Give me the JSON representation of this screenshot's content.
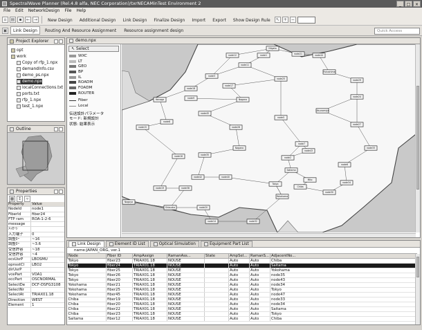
{
  "window": {
    "title": "SpectralWave Planner (Rel.4.8 alfa, NEC Corporation)/txrNECAMinTest Environment 2",
    "controls": [
      "_",
      "□",
      "×"
    ]
  },
  "menu": [
    "File",
    "Edit",
    "NetworkDesign",
    "File",
    "Help"
  ],
  "toolbar": {
    "buttons": [
      "New Design",
      "Additional Design",
      "Link Design",
      "Finalize Design",
      "Import",
      "Export",
      "Show Design Rule"
    ],
    "zoom": ""
  },
  "toolbar2": {
    "tabs": [
      "Link Design",
      "Routing And Resource Assignment",
      "Resource assignment design"
    ],
    "quick_access": "Quick Access"
  },
  "project_explorer": {
    "title": "Project Explorer",
    "items": [
      {
        "label": "opt",
        "type": "folder",
        "level": 0
      },
      {
        "label": "work",
        "type": "folder",
        "level": 0
      },
      {
        "label": "Copy of rfp_1.npx",
        "type": "file",
        "level": 1
      },
      {
        "label": "demandInfo.csv",
        "type": "file",
        "level": 1
      },
      {
        "label": "demo_ps.npx",
        "type": "file",
        "level": 1
      },
      {
        "label": "demo.npx",
        "type": "file",
        "level": 1,
        "selected": true
      },
      {
        "label": "localConnections.txt",
        "type": "file",
        "level": 1
      },
      {
        "label": "ports.txt",
        "type": "file",
        "level": 1
      },
      {
        "label": "rfp_1.npx",
        "type": "file",
        "level": 1
      },
      {
        "label": "test_1.npx",
        "type": "file",
        "level": 1
      }
    ]
  },
  "outline": {
    "title": "Outline"
  },
  "properties": {
    "title": "Properties",
    "col_property": "Property",
    "col_value": "Value",
    "rows": [
      [
        "NodeId",
        "node1"
      ],
      [
        "FiberId",
        "fiber24"
      ],
      [
        "FTP ram",
        "ROA-1-2-6"
      ],
      [
        "message",
        ""
      ],
      [
        "ﾒｯｾｰｼﾞ",
        ""
      ],
      [
        "入力端子",
        "0"
      ],
      [
        "調整ｶｰ",
        "~16"
      ],
      [
        "調整ｶｰ",
        "~3.6"
      ],
      [
        "受信許容",
        "~18"
      ],
      [
        "受信許容",
        "~4"
      ],
      [
        "ocsUsrP",
        "LBOSMU"
      ],
      [
        "opnsstCl",
        "LBO2"
      ],
      [
        "dirUsrP",
        ""
      ],
      [
        "vcePart",
        "VOA1"
      ],
      [
        "occPart",
        "OSCNORMAL"
      ],
      [
        "SelectDe",
        "DCF-DSFG3108"
      ],
      [
        "SelectNr",
        ""
      ],
      [
        "SelectAt",
        "TRIAX01.18"
      ],
      [
        "Direction",
        "WEST"
      ],
      [
        "Element",
        "1"
      ]
    ]
  },
  "map": {
    "title": "demo.npx",
    "select": "Select",
    "legend": [
      {
        "label": "WXC",
        "color": "#9a9a9a"
      },
      {
        "label": "LT",
        "color": "#bbbbbb"
      },
      {
        "label": "GEO",
        "color": "#777777"
      },
      {
        "label": "BP",
        "color": "#555555"
      },
      {
        "label": "IL",
        "color": "#999999"
      },
      {
        "label": "ROADM",
        "color": "#444444"
      },
      {
        "label": "FOADM",
        "color": "#666666"
      },
      {
        "label": "ROUTER",
        "color": "#222222"
      },
      {
        "label": "Fiber",
        "color": "#333333"
      },
      {
        "label": "Local",
        "color": "#888888"
      },
      {
        "label": "伝送設計パラメータ",
        "color": ""
      },
      {
        "label": "モード: 新規設計",
        "color": ""
      },
      {
        "label": "状態: 結果表示",
        "color": ""
      }
    ],
    "nodes": [
      "Niigata",
      "node12",
      "node1",
      "node21",
      "node44",
      "node11",
      "Fukushima",
      "node3",
      "node25",
      "node29",
      "node18",
      "node17",
      "node24",
      "Yamaga",
      "node9",
      "Nagano",
      "node45",
      "Utsunomiya",
      "node26",
      "node5",
      "node27",
      "node8",
      "node15",
      "Nagano",
      "node7",
      "node33",
      "node43",
      "node16",
      "node35",
      "node2",
      "node6",
      "Saitama",
      "Mito",
      "node42",
      "node40",
      "node34",
      "Tokyo",
      "Chiba",
      "Yokohama",
      "node19",
      "node38",
      "node30",
      "Nagoya",
      "Shizuoka",
      "node20",
      "node14",
      "node32"
    ]
  },
  "bottom": {
    "tabs": [
      "Link Design",
      "Element ID List",
      "Optical Simulation",
      "Equipment Part List"
    ],
    "caption": "name:JAPAN_ORG, ver.1",
    "columns": [
      "Node",
      "Fiber ID",
      "AmpAssign",
      "RamanAss...",
      "State",
      "AmpSel...",
      "RamanS...",
      "AdjacentNo..."
    ],
    "rows": [
      [
        "Tokyo",
        "fiber23",
        "TRIAX01.18",
        "NOUSE",
        "",
        "Auto",
        "Auto",
        "Chiba"
      ],
      [
        "Tokyo",
        "fiber24",
        "TRIAX01.18",
        "NOUSE",
        "",
        "Auto",
        "Auto",
        "Saitama"
      ],
      [
        "Tokyo",
        "fiber25",
        "TRIAX01.18",
        "NOUSE",
        "",
        "Auto",
        "Auto",
        "Yokohama"
      ],
      [
        "Tokyo",
        "fiber26",
        "TRIAX01.18",
        "NOUSE",
        "",
        "Auto",
        "Auto",
        "node35"
      ],
      [
        "Tokyo",
        "fiber20",
        "TRIAX01.18",
        "NOUSE",
        "",
        "Auto",
        "Auto",
        "node43"
      ],
      [
        "Yokohama",
        "fiber21",
        "TRIAX01.18",
        "NOUSE",
        "",
        "Auto",
        "Auto",
        "node34"
      ],
      [
        "Yokohama",
        "fiber25",
        "TRIAX01.18",
        "NOUSE",
        "",
        "Auto",
        "Auto",
        "Tokyo"
      ],
      [
        "Yokohama",
        "fiber45",
        "TRIAX01.18",
        "NOUSE",
        "",
        "Auto",
        "Auto",
        "node47"
      ],
      [
        "Chiba",
        "fiber19",
        "TRIAX01.18",
        "NOUSE",
        "",
        "Auto",
        "Auto",
        "node33"
      ],
      [
        "Chiba",
        "fiber20",
        "TRIAX01.18",
        "NOUSE",
        "",
        "Auto",
        "Auto",
        "node34"
      ],
      [
        "Chiba",
        "fiber22",
        "TRIAX01.18",
        "NOUSE",
        "",
        "Auto",
        "Auto",
        "Saitama"
      ],
      [
        "Chiba",
        "fiber23",
        "TRIAX01.18",
        "NOUSE",
        "",
        "Auto",
        "Auto",
        "Tokyo"
      ],
      [
        "Saitama",
        "fiber12",
        "TRIAX01.18",
        "NOUSE",
        "",
        "Auto",
        "Auto",
        "Chiba"
      ]
    ]
  }
}
